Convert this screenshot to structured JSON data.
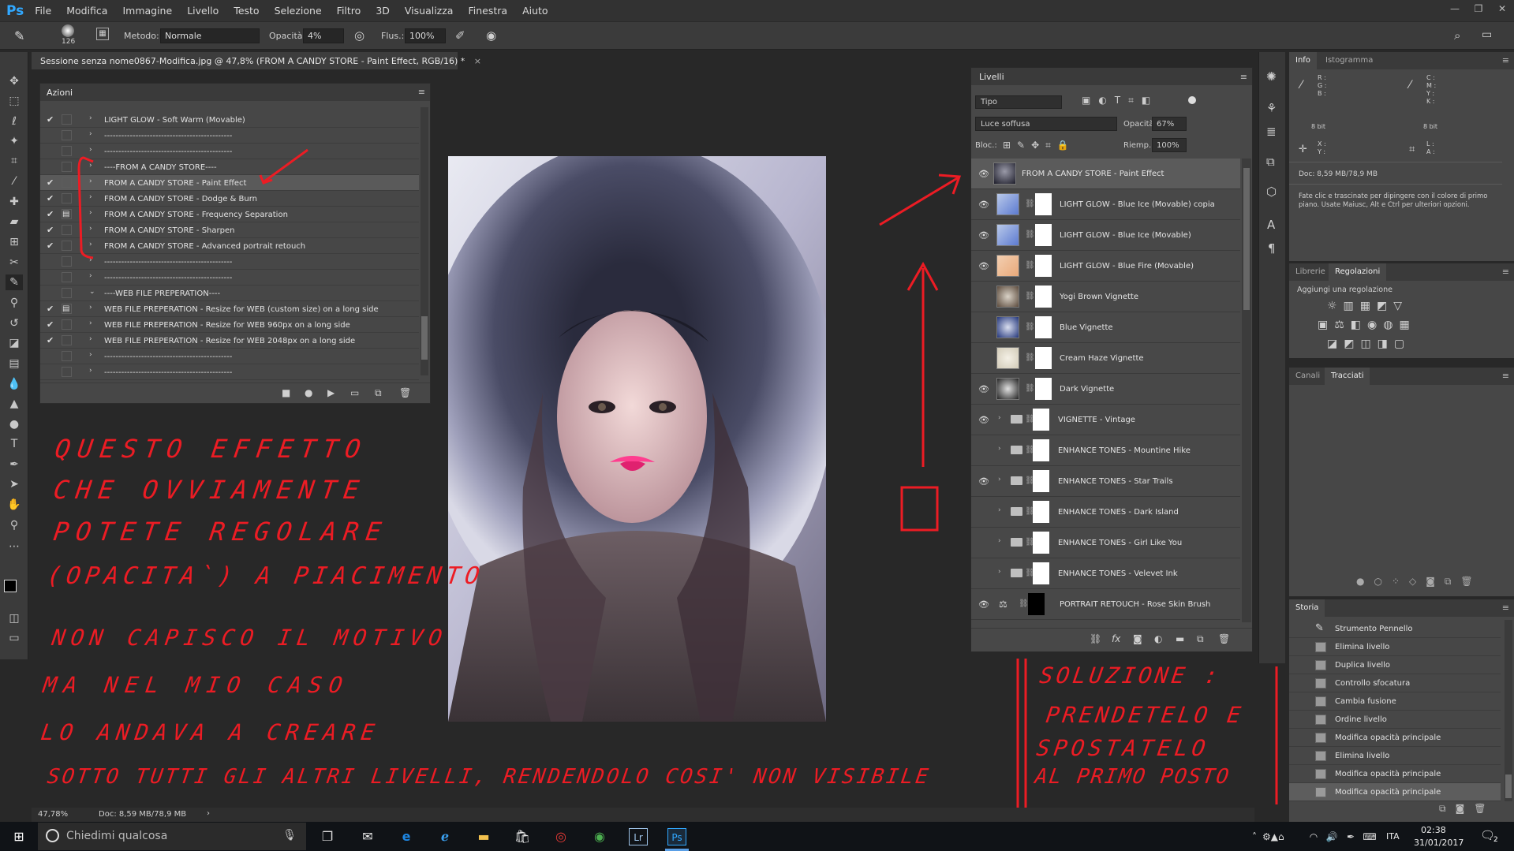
{
  "menu": {
    "logo": "Ps",
    "items": [
      "File",
      "Modifica",
      "Immagine",
      "Livello",
      "Testo",
      "Selezione",
      "Filtro",
      "3D",
      "Visualizza",
      "Finestra",
      "Aiuto"
    ]
  },
  "options": {
    "brush_size": "126",
    "metodo_label": "Metodo:",
    "metodo_value": "Normale",
    "opacita_label": "Opacità:",
    "opacita_value": "4%",
    "flusso_label": "Flus.:",
    "flusso_value": "100%"
  },
  "document": {
    "tab_title": "Sessione senza nome0867-Modifica.jpg @ 47,8% (FROM A CANDY STORE - Paint Effect, RGB/16) *",
    "zoom": "47,78%",
    "doc_size": "Doc: 8,59 MB/78,9 MB"
  },
  "actions_panel": {
    "tab": "Azioni",
    "rows": [
      {
        "check": "✔",
        "text": "LIGHT GLOW - Soft Warm (Movable)",
        "box": ""
      },
      {
        "check": "",
        "text": "---------------------------------------------",
        "box": ""
      },
      {
        "check": "",
        "text": "---------------------------------------------",
        "box": ""
      },
      {
        "check": "",
        "text": "----FROM A CANDY STORE----",
        "box": ""
      },
      {
        "check": "✔",
        "text": "FROM A CANDY STORE - Paint Effect",
        "box": "",
        "selected": true
      },
      {
        "check": "✔",
        "text": "FROM A CANDY STORE - Dodge & Burn",
        "box": ""
      },
      {
        "check": "✔",
        "text": "FROM A CANDY STORE - Frequency Separation",
        "box": "▤"
      },
      {
        "check": "✔",
        "text": "FROM A CANDY STORE - Sharpen",
        "box": ""
      },
      {
        "check": "✔",
        "text": "FROM A CANDY STORE - Advanced portrait retouch",
        "box": ""
      },
      {
        "check": "",
        "text": "---------------------------------------------",
        "box": ""
      },
      {
        "check": "",
        "text": "---------------------------------------------",
        "box": ""
      },
      {
        "check": "",
        "text": "----WEB FILE PREPERATION----",
        "box": ""
      },
      {
        "check": "✔",
        "text": "WEB FILE PREPERATION - Resize for WEB (custom size) on a long side",
        "box": "▤"
      },
      {
        "check": "✔",
        "text": "WEB FILE PREPERATION - Resize for WEB 960px on a long side",
        "box": ""
      },
      {
        "check": "✔",
        "text": "WEB FILE PREPERATION - Resize for WEB 2048px on a long side",
        "box": ""
      },
      {
        "check": "",
        "text": "---------------------------------------------",
        "box": ""
      },
      {
        "check": "",
        "text": "---------------------------------------------",
        "box": ""
      }
    ]
  },
  "layers_panel": {
    "tab": "Livelli",
    "filter": "Tipo",
    "blend_mode": "Luce soffusa",
    "opacity_label": "Opacità:",
    "opacity_value": "67%",
    "lock_label": "Bloc.:",
    "fill_label": "Riemp.:",
    "fill_value": "100%",
    "layers": [
      {
        "name": "FROM A CANDY STORE - Paint Effect",
        "visible": true,
        "kind": "pixel",
        "selected": true
      },
      {
        "name": "LIGHT GLOW - Blue Ice (Movable) copia",
        "visible": true,
        "kind": "gradient-blue"
      },
      {
        "name": "LIGHT GLOW - Blue Ice (Movable)",
        "visible": true,
        "kind": "gradient-blue"
      },
      {
        "name": "LIGHT GLOW - Blue Fire (Movable)",
        "visible": true,
        "kind": "gradient-warm"
      },
      {
        "name": "Yogi Brown Vignette",
        "visible": false,
        "kind": "gradient-brown"
      },
      {
        "name": "Blue Vignette",
        "visible": false,
        "kind": "gradient-navy"
      },
      {
        "name": "Cream Haze Vignette",
        "visible": false,
        "kind": "gradient-cream"
      },
      {
        "name": "Dark Vignette",
        "visible": true,
        "kind": "gradient-dark"
      },
      {
        "name": "VIGNETTE - Vintage",
        "visible": true,
        "kind": "folder"
      },
      {
        "name": "ENHANCE TONES - Mountine Hike",
        "visible": false,
        "kind": "folder"
      },
      {
        "name": "ENHANCE TONES - Star Trails",
        "visible": true,
        "kind": "folder"
      },
      {
        "name": "ENHANCE TONES - Dark Island",
        "visible": false,
        "kind": "folder"
      },
      {
        "name": "ENHANCE TONES - Girl Like You",
        "visible": false,
        "kind": "folder"
      },
      {
        "name": "ENHANCE TONES - Velevet Ink",
        "visible": false,
        "kind": "folder"
      },
      {
        "name": "PORTRAIT RETOUCH - Rose Skin Brush",
        "visible": true,
        "kind": "adjust"
      }
    ]
  },
  "info_panel": {
    "tabs": [
      "Info",
      "Istogramma"
    ],
    "rgb_labels": "R :\nG :\nB :",
    "cmyk_labels": "C :\nM :\nY :\nK :",
    "bits_left": "8 bit",
    "bits_right": "8 bit",
    "xy": "X :\nY :",
    "la": "L :\nA :",
    "doc": "Doc: 8,59 MB/78,9 MB",
    "hint": "Fate clic e trascinate per dipingere con il colore di primo piano. Usate Maiusc, Alt e Ctrl per ulteriori opzioni."
  },
  "adjust_panel": {
    "tabs": [
      "Librerie",
      "Regolazioni"
    ],
    "title": "Aggiungi una regolazione"
  },
  "paths_panel": {
    "tabs": [
      "Canali",
      "Tracciati"
    ]
  },
  "history_panel": {
    "tab": "Storia",
    "items": [
      "Strumento Pennello",
      "Elimina livello",
      "Duplica livello",
      "Controllo sfocatura",
      "Cambia fusione",
      "Ordine livello",
      "Modifica opacità principale",
      "Elimina livello",
      "Modifica opacità principale",
      "Modifica opacità principale"
    ]
  },
  "taskbar": {
    "search_placeholder": "Chiedimi qualcosa",
    "language": "ITA",
    "time": "02:38",
    "date": "31/01/2017",
    "notif_count": "2"
  },
  "annotations": {
    "left_lines": [
      "QUESTO EFFETTO",
      "CHE OVVIAMENTE",
      "POTETE REGOLARE",
      "(OPACITA`) A PIACIMENTO",
      "NON CAPISCO IL MOTIVO",
      "MA NEL MIO CASO",
      "LO ANDAVA A CREARE",
      "SOTTO TUTTI GLI ALTRI LIVELLI, RENDENDOLO COSI' NON VISIBILE"
    ],
    "right_lines": [
      "SOLUZIONE :",
      "PRENDETELO E",
      "SPOSTATELO",
      "AL PRIMO POSTO"
    ],
    "color": "#ec1c24"
  },
  "theme": {
    "accent_ps": "#31a8ff",
    "panel_bg": "#474747",
    "canvas_bg": "#282828"
  }
}
